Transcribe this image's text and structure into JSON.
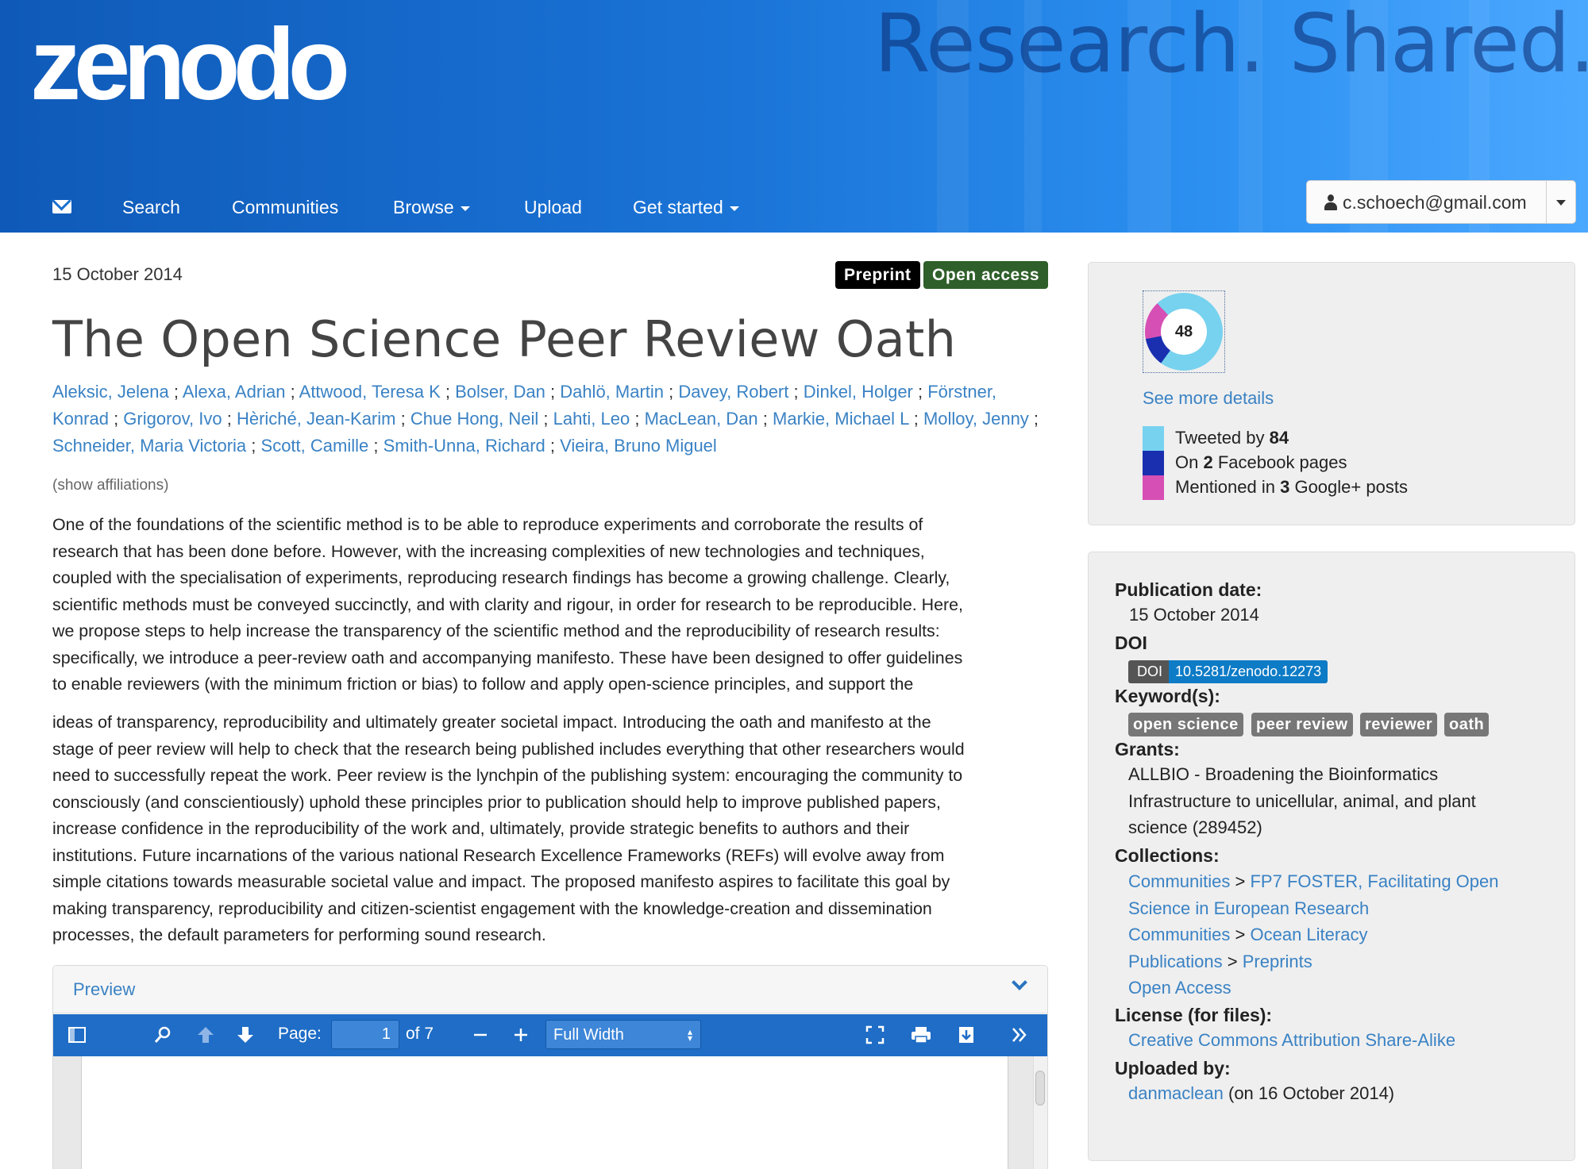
{
  "header": {
    "logo": "zenodo",
    "tagline": "Research. Shared.",
    "nav": [
      "Search",
      "Communities",
      "Browse",
      "Upload",
      "Get started"
    ],
    "user_email": "c.schoech@gmail.com"
  },
  "record": {
    "date": "15 October 2014",
    "badges": {
      "type": "Preprint",
      "access": "Open access"
    },
    "colors": {
      "preprint": "#000000",
      "open_access": "#2f5f2a",
      "link": "#3a82c4",
      "header_blue": "#1a73d6"
    },
    "title": "The Open Science Peer Review Oath",
    "authors": [
      "Aleksic, Jelena",
      "Alexa, Adrian",
      "Attwood, Teresa K",
      "Bolser, Dan",
      "Dahlö, Martin",
      "Davey, Robert",
      "Dinkel, Holger",
      "Förstner, Konrad",
      "Grigorov, Ivo",
      "Hèriché, Jean-Karim",
      "Chue Hong, Neil",
      "Lahti, Leo",
      "MacLean, Dan",
      "Markie, Michael L",
      "Molloy, Jenny",
      "Schneider, Maria Victoria",
      "Scott, Camille",
      "Smith-Unna, Richard",
      "Vieira, Bruno Miguel"
    ],
    "show_affiliations": "(show affiliations)",
    "abstract_lines": [
      "One of the foundations of the scientific method is to be able to reproduce experiments and corroborate the results of",
      "research that has been done before. However, with the increasing complexities of new technologies and techniques,",
      "coupled with the specialisation of experiments, reproducing research findings has become a growing challenge. Clearly,",
      "scientific methods must be conveyed succinctly, and with clarity and rigour, in order for research to be reproducible. Here,",
      "we propose steps to help increase the transparency of the scientific method and the reproducibility of research results:",
      "specifically, we introduce a peer-review oath and accompanying manifesto. These have been designed to offer guidelines",
      "to enable reviewers (with the minimum friction or bias) to follow and apply open-science principles, and support the",
      "ideas of transparency, reproducibility and ultimately greater societal impact. Introducing the oath and manifesto at the",
      "stage of peer review will help to check that the research being published includes everything that other researchers would",
      "need to successfully repeat the work. Peer review is the lynchpin of the publishing system: encouraging the community to",
      "consciously (and conscientiously) uphold these principles prior to publication should help to improve published papers,",
      "increase confidence in the reproducibility of the work and, ultimately, provide strategic benefits to authors and their",
      "institutions. Future incarnations of the various national Research Excellence Frameworks (REFs) will evolve away from",
      "simple citations towards measurable societal value and impact. The proposed manifesto aspires to facilitate this goal by",
      "making transparency, reproducibility and citizen-scientist engagement with the knowledge-creation and dissemination",
      "processes, the default parameters for performing sound research."
    ]
  },
  "preview": {
    "title": "Preview",
    "page_label": "Page:",
    "page_value": "1",
    "page_of": "of 7",
    "zoom": "Full Width"
  },
  "altmetric": {
    "score": "48",
    "see_more": "See more details",
    "tweeted_pre": "Tweeted by ",
    "tweeted_n": "84",
    "facebook_pre": "On ",
    "facebook_n": "2",
    "facebook_post": " Facebook pages",
    "google_pre": "Mentioned in ",
    "google_n": "3",
    "google_post": " Google+ posts",
    "colors": {
      "twitter": "#76d2ef",
      "facebook": "#1a2fb0",
      "google": "#d64fb4"
    }
  },
  "meta": {
    "pub_date_label": "Publication date:",
    "pub_date": "15 October 2014",
    "doi_label": "DOI",
    "doi_key": "DOI",
    "doi": "10.5281/zenodo.12273",
    "keywords_label": "Keyword(s):",
    "keywords": [
      "open science",
      "peer review",
      "reviewer",
      "oath"
    ],
    "grants_label": "Grants:",
    "grant_lines": [
      "ALLBIO - Broadening the Bioinformatics",
      "Infrastructure to unicellular, animal, and plant",
      "science (289452)"
    ],
    "collections_label": "Collections:",
    "collections": {
      "c1_a": "Communities",
      "sep": ">",
      "c1_b": "FP7 FOSTER, Facilitating Open",
      "c1_b2": "Science in European Research",
      "c2_a": "Communities",
      "c2_b": "Ocean Literacy",
      "c3_a": "Publications",
      "c3_b": "Preprints",
      "c4": "Open Access"
    },
    "license_label": "License (for files):",
    "license": "Creative Commons Attribution Share-Alike",
    "uploaded_label": "Uploaded by:",
    "uploader": "danmaclean",
    "uploaded_on": "(on 16 October 2014)"
  }
}
